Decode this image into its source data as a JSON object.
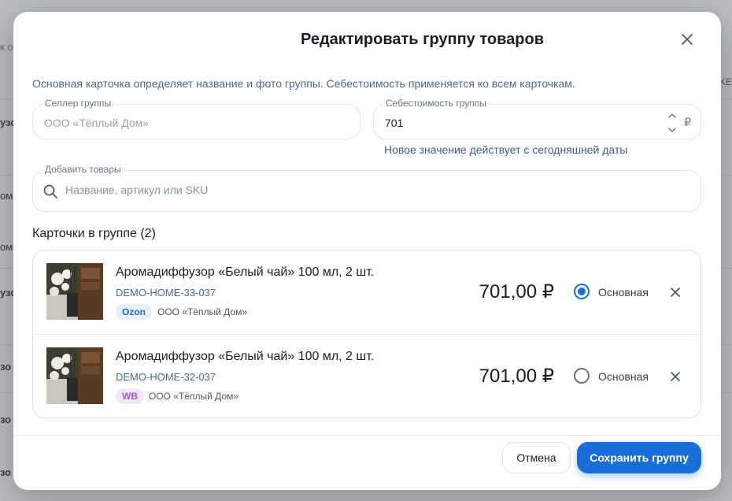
{
  "background": {
    "fragments": [
      "к о",
      "узо",
      "ома",
      "ома",
      "узо",
      "зо",
      "зо",
      "зо"
    ],
    "right_fragment": "KE"
  },
  "modal": {
    "title": "Редактировать группу товаров",
    "subtitle": "Основная карточка определяет название и фото группы. Себестоимость применяется ко всем карточкам.",
    "seller": {
      "label": "Селлер группы",
      "value": "ООО «Тёплый Дом»"
    },
    "cost": {
      "label": "Себестоимость группы",
      "value": "701",
      "currency": "₽",
      "hint": "Новое значение действует с сегодняшней даты"
    },
    "add_products": {
      "label": "Добавить товары",
      "placeholder": "Название, артикул или SKU",
      "value": ""
    },
    "cards_title": "Карточки в группе (2)",
    "cards": [
      {
        "name": "Аромадиффузор «Белый чай» 100 мл, 2 шт.",
        "sku": "DEMO-HOME-33-037",
        "marketplace": "Ozon",
        "seller": "ООО «Тёплый Дом»",
        "price": "701,00 ₽",
        "primary_label": "Основная",
        "is_primary": true
      },
      {
        "name": "Аромадиффузор «Белый чай» 100 мл, 2 шт.",
        "sku": "DEMO-HOME-32-037",
        "marketplace": "WB",
        "seller": "ООО «Тёплый Дом»",
        "price": "701,00 ₽",
        "primary_label": "Основная",
        "is_primary": false
      }
    ],
    "buttons": {
      "cancel": "Отмена",
      "save": "Сохранить группу"
    }
  },
  "colors": {
    "accent": "#1a6ed8",
    "ozon_badge": "#2b6cc4",
    "wb_badge": "#a45ad9"
  },
  "icons": [
    "close-icon",
    "chevron-up-icon",
    "chevron-down-icon",
    "search-icon",
    "remove-icon"
  ]
}
